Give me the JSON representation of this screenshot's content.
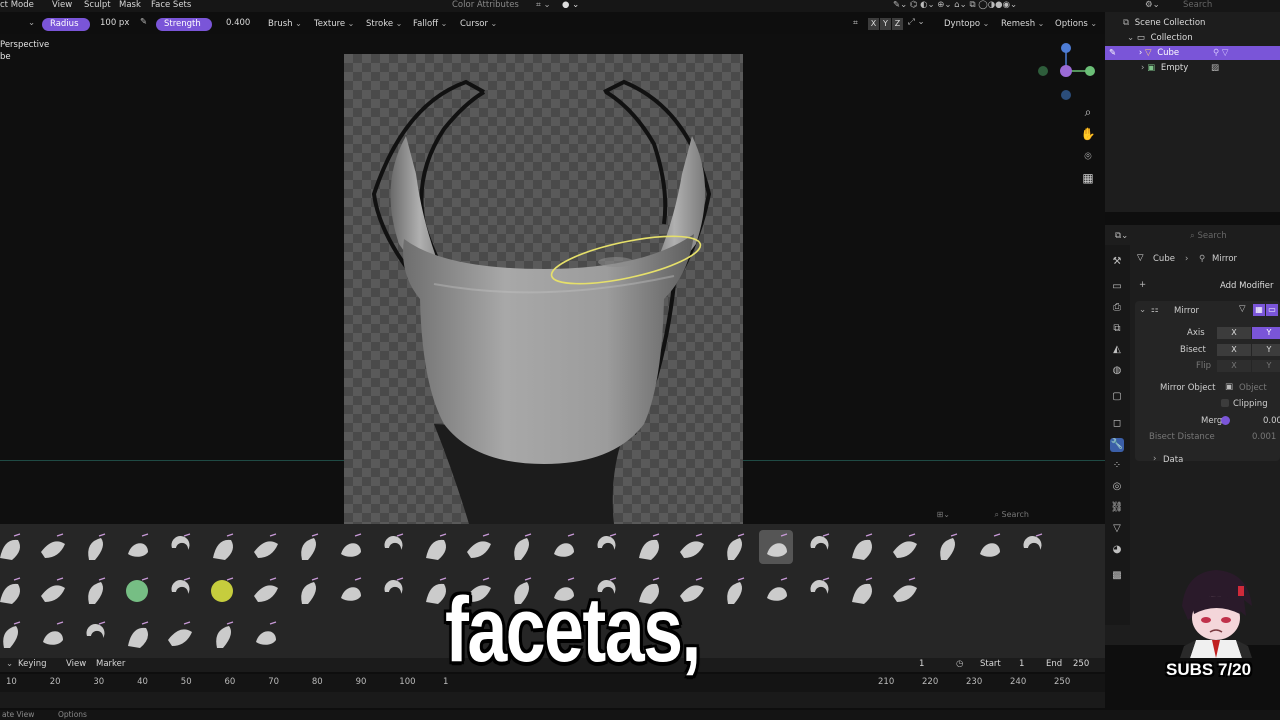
{
  "header": {
    "mode": "ct Mode",
    "menus": [
      "View",
      "Sculpt",
      "Mask",
      "Face Sets"
    ],
    "color_attributes": "Color Attributes",
    "search_placeholder": "Search"
  },
  "tool_settings": {
    "radius_label": "Radius",
    "radius_value": "100 px",
    "strength_label": "Strength",
    "strength_value": "0.400",
    "dropdowns": [
      "Brush",
      "Texture",
      "Stroke",
      "Falloff",
      "Cursor"
    ],
    "symmetry": [
      "X",
      "Y",
      "Z"
    ],
    "right_dropdowns": [
      "Dyntopo",
      "Remesh",
      "Options"
    ]
  },
  "viewport": {
    "view_label": "Perspective",
    "object_label": "be",
    "accent_color": "#7a55d8"
  },
  "outliner": {
    "title": "Scene Collection",
    "items": [
      {
        "label": "Collection"
      },
      {
        "label": "Cube"
      },
      {
        "label": "Empty"
      }
    ]
  },
  "properties": {
    "search_placeholder": "Search",
    "breadcrumb": [
      "Cube",
      "Mirror"
    ],
    "add_modifier": "Add Modifier",
    "modifier_name": "Mirror",
    "axis_label": "Axis",
    "bisect_label": "Bisect",
    "flip_label": "Flip",
    "axis_buttons": [
      "X",
      "Y"
    ],
    "mirror_object_label": "Mirror Object",
    "mirror_object_value": "Object",
    "clipping_label": "Clipping",
    "merge_label": "Merge",
    "merge_value": "0.00",
    "bisect_distance_label": "Bisect Distance",
    "bisect_distance_value": "0.001",
    "data_label": "Data"
  },
  "brush_shelf": {
    "search_placeholder": "Search"
  },
  "timeline": {
    "menus": [
      "Keying",
      "View",
      "Marker"
    ],
    "current_frame": "1",
    "start_label": "Start",
    "start_value": "1",
    "end_label": "End",
    "end_value": "250",
    "ruler_left": [
      "10",
      "20",
      "30",
      "40",
      "50",
      "60",
      "70",
      "80",
      "90",
      "100",
      "1"
    ],
    "ruler_right": [
      "210",
      "220",
      "230",
      "240",
      "250"
    ]
  },
  "status_bar": {
    "items": [
      "ate View",
      "Options"
    ]
  },
  "overlay": {
    "subtitle": "facetas,",
    "subs_counter": "SUBS 7/20"
  }
}
